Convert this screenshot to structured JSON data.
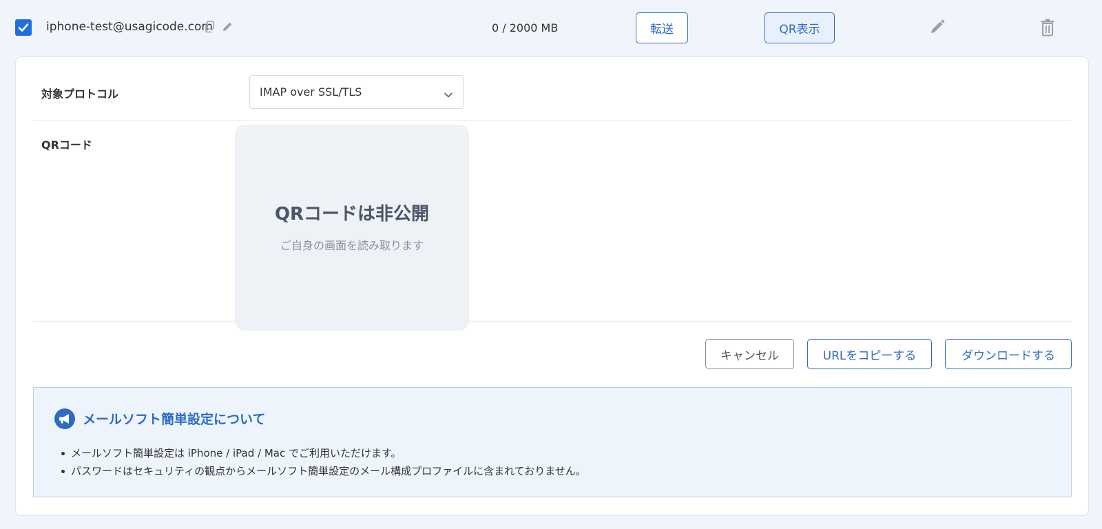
{
  "account": {
    "email": "iphone-test@usagicode.com",
    "usage": "0 / 2000 MB",
    "forward_label": "転送",
    "qr_label": "QR表示",
    "checked": true
  },
  "form": {
    "protocol_label": "対象プロトコル",
    "protocol_value": "IMAP over SSL/TLS",
    "qr_label": "QRコード",
    "qr_title": "QRコードは非公開",
    "qr_sub": "ご自身の画面を読み取ります"
  },
  "actions": {
    "cancel": "キャンセル",
    "copy_url": "URLをコピーする",
    "download": "ダウンロードする"
  },
  "info": {
    "title": "メールソフト簡単設定について",
    "items": [
      "メールソフト簡単設定は iPhone / iPad / Mac でご利用いただけます。",
      "パスワードはセキュリティの観点からメールソフト簡単設定のメール構成プロファイルに含まれておりません。"
    ]
  },
  "colors": {
    "accent": "#2d6bc4",
    "checkbox": "#1f6fe0",
    "info_bg": "#eef4fc"
  }
}
